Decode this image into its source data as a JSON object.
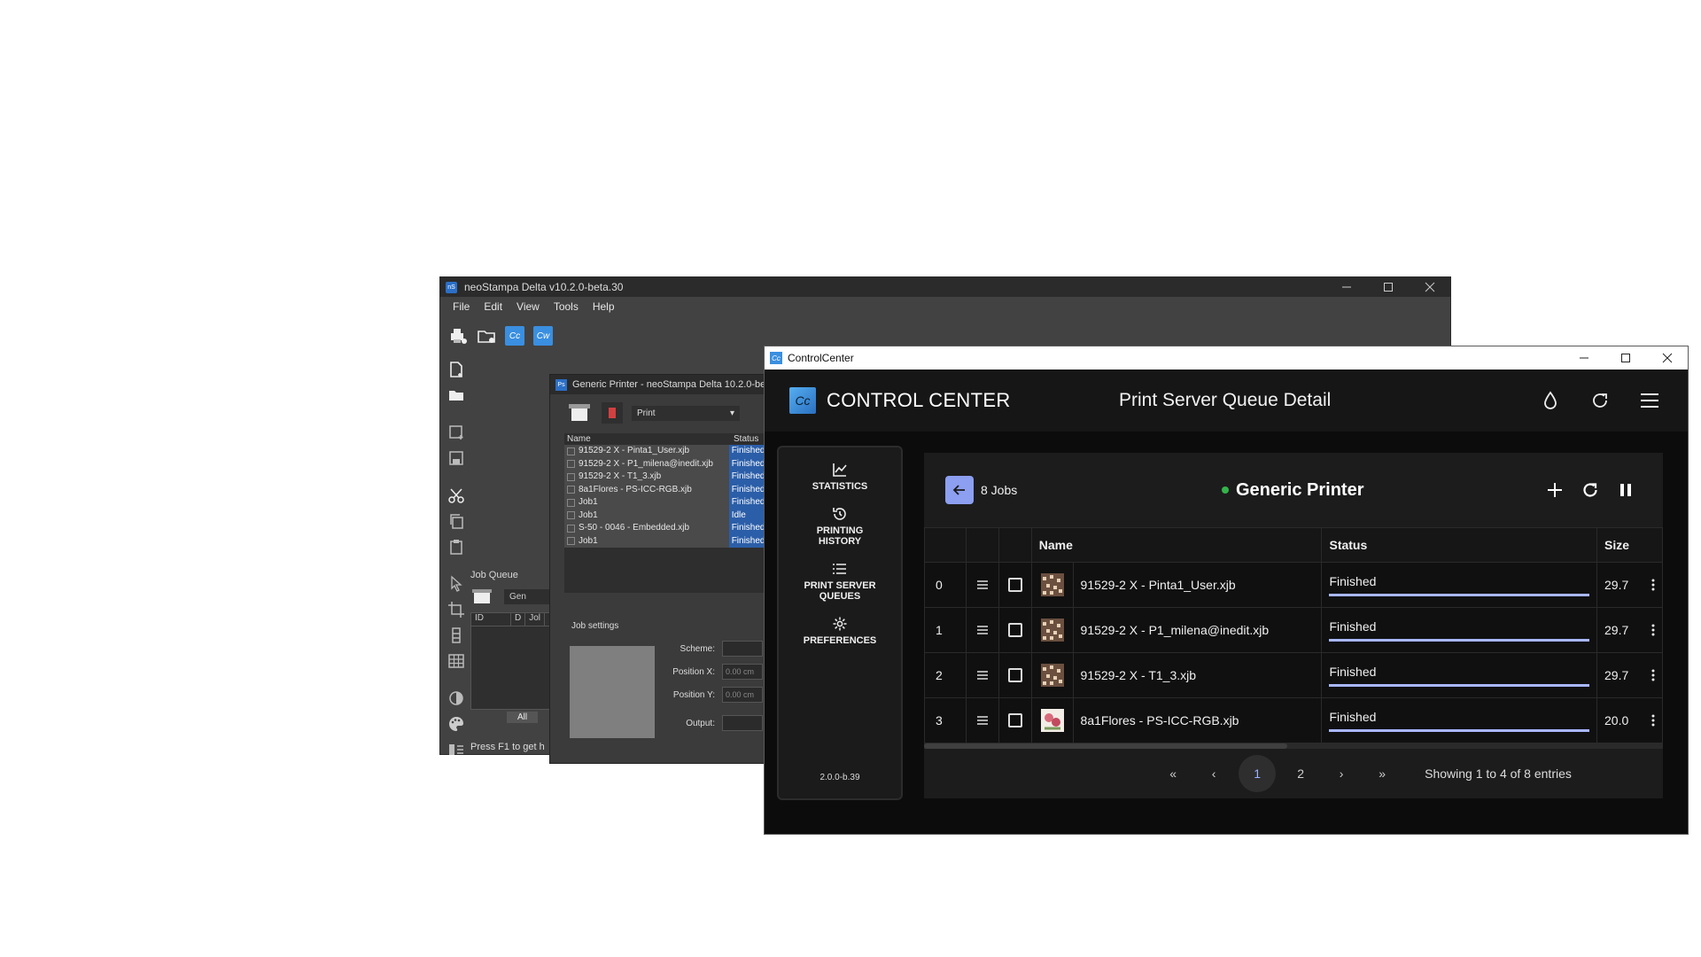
{
  "neostampa": {
    "title": "neoStampa Delta  v10.2.0-beta.30",
    "logo_text": "nS",
    "menu": [
      "File",
      "Edit",
      "View",
      "Tools",
      "Help"
    ],
    "toolbar_tiles": [
      "Cc",
      "Cw"
    ],
    "job_queue": {
      "title": "Job Queue",
      "printer_combo": "Gen",
      "columns": [
        "ID",
        "D",
        "Jol"
      ],
      "all_tab": "All"
    },
    "status": "Press F1 to get h"
  },
  "generic_printer": {
    "title": "Generic Printer - neoStampa Delta 10.2.0-be",
    "logo_text": "Ps",
    "action": "Print",
    "columns": [
      "Name",
      "Status"
    ],
    "jobs": [
      {
        "name": "91529-2 X - Pinta1_User.xjb",
        "status": "Finished"
      },
      {
        "name": "91529-2 X - P1_milena@inedit.xjb",
        "status": "Finished"
      },
      {
        "name": "91529-2 X - T1_3.xjb",
        "status": "Finished"
      },
      {
        "name": "8a1Flores - PS-ICC-RGB.xjb",
        "status": "Finished"
      },
      {
        "name": "Job1",
        "status": "Finished"
      },
      {
        "name": "Job1",
        "status": "Idle"
      },
      {
        "name": "S-50 - 0046 - Embedded.xjb",
        "status": "Finished"
      },
      {
        "name": "Job1",
        "status": "Finished"
      }
    ],
    "settings": {
      "title": "Job settings",
      "scheme_label": "Scheme:",
      "pos_x_label": "Position X:",
      "pos_x_value": "0.00 cm",
      "pos_y_label": "Position Y:",
      "pos_y_value": "0.00 cm",
      "output_label": "Output:"
    }
  },
  "control_center": {
    "window_title": "ControlCenter",
    "logo_text": "Cc",
    "brand": "CONTROL CENTER",
    "page_title": "Print Server Queue Detail",
    "nav": [
      {
        "label": "STATISTICS",
        "icon": "chart-icon"
      },
      {
        "label": "PRINTING HISTORY",
        "icon": "history-icon"
      },
      {
        "label": "PRINT SERVER QUEUES",
        "icon": "list-icon"
      },
      {
        "label": "PREFERENCES",
        "icon": "gear-icon"
      }
    ],
    "version": "2.0.0-b.39",
    "jobs_count": "8 Jobs",
    "printer_name": "Generic Printer",
    "printer_status_color": "#34b34a",
    "columns": {
      "name": "Name",
      "status": "Status",
      "size": "Size"
    },
    "rows": [
      {
        "index": "0",
        "name": "91529-2 X - Pinta1_User.xjb",
        "status": "Finished",
        "progress": 1.0,
        "size": "29.7"
      },
      {
        "index": "1",
        "name": "91529-2 X - P1_milena@inedit.xjb",
        "status": "Finished",
        "progress": 1.0,
        "size": "29.7"
      },
      {
        "index": "2",
        "name": "91529-2 X - T1_3.xjb",
        "status": "Finished",
        "progress": 1.0,
        "size": "29.7"
      },
      {
        "index": "3",
        "name": "8a1Flores - PS-ICC-RGB.xjb",
        "status": "Finished",
        "progress": 1.0,
        "size": "20.0"
      }
    ],
    "pagination": {
      "first": "«",
      "prev": "‹",
      "pages": [
        "1",
        "2"
      ],
      "current": "1",
      "next": "›",
      "last": "»",
      "summary": "Showing 1 to 4 of 8 entries"
    },
    "accent_color": "#8c9ff0"
  }
}
